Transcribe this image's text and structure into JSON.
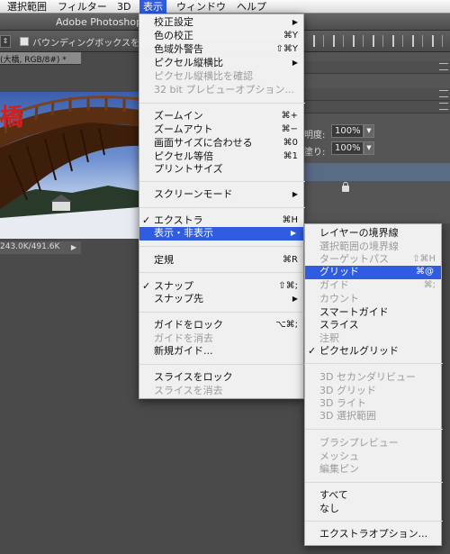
{
  "menubar": {
    "items": [
      {
        "label": "選択範囲"
      },
      {
        "label": "フィルター"
      },
      {
        "label": "3D"
      },
      {
        "label": "表示"
      },
      {
        "label": "ウィンドウ"
      },
      {
        "label": "ヘルプ"
      }
    ]
  },
  "app": {
    "title": "Adobe Photoshop",
    "options_bar": {
      "checkbox_label": "バウンディングボックスを表示",
      "select_arrow": "⇕"
    },
    "doc_tab": "(大橋, RGB/8#) *",
    "status": "243.0K/491.6K",
    "status_arrow": "▶",
    "canvas_text": "橋",
    "panel": {
      "opacity_label": "明度:",
      "opacity_value": "100%",
      "fill_label": "塗り:",
      "fill_value": "100%",
      "arrow": "▼"
    }
  },
  "view_menu": {
    "items": [
      {
        "label": "校正設定",
        "shortcut": "",
        "submenu": true,
        "disabled": false
      },
      {
        "label": "色の校正",
        "shortcut": "⌘Y",
        "disabled": false
      },
      {
        "label": "色域外警告",
        "shortcut": "⇧⌘Y",
        "disabled": false
      },
      {
        "label": "ピクセル縦横比",
        "shortcut": "",
        "submenu": true,
        "disabled": false
      },
      {
        "label": "ピクセル縦横比を確認",
        "shortcut": "",
        "disabled": true
      },
      {
        "label": "32 bit プレビューオプション...",
        "shortcut": "",
        "disabled": true
      },
      {
        "label": "ズームイン",
        "shortcut": "⌘+",
        "disabled": false
      },
      {
        "label": "ズームアウト",
        "shortcut": "⌘−",
        "disabled": false
      },
      {
        "label": "画面サイズに合わせる",
        "shortcut": "⌘0",
        "disabled": false
      },
      {
        "label": "ピクセル等倍",
        "shortcut": "⌘1",
        "disabled": false
      },
      {
        "label": "プリントサイズ",
        "shortcut": "",
        "disabled": false
      },
      {
        "label": "スクリーンモード",
        "shortcut": "",
        "submenu": true,
        "disabled": false
      },
      {
        "label": "エクストラ",
        "shortcut": "⌘H",
        "checked": true,
        "disabled": false
      },
      {
        "label": "表示・非表示",
        "shortcut": "",
        "submenu": true,
        "highlighted": true,
        "disabled": false
      },
      {
        "label": "定規",
        "shortcut": "⌘R",
        "disabled": false
      },
      {
        "label": "スナップ",
        "shortcut": "⇧⌘;",
        "checked": true,
        "disabled": false
      },
      {
        "label": "スナップ先",
        "shortcut": "",
        "submenu": true,
        "disabled": false
      },
      {
        "label": "ガイドをロック",
        "shortcut": "⌥⌘;",
        "disabled": false
      },
      {
        "label": "ガイドを消去",
        "shortcut": "",
        "disabled": true
      },
      {
        "label": "新規ガイド...",
        "shortcut": "",
        "disabled": false
      },
      {
        "label": "スライスをロック",
        "shortcut": "",
        "disabled": false
      },
      {
        "label": "スライスを消去",
        "shortcut": "",
        "disabled": true
      }
    ]
  },
  "show_submenu": {
    "items": [
      {
        "label": "レイヤーの境界線",
        "shortcut": "",
        "disabled": false
      },
      {
        "label": "選択範囲の境界線",
        "shortcut": "",
        "disabled": true
      },
      {
        "label": "ターゲットパス",
        "shortcut": "⇧⌘H",
        "disabled": true
      },
      {
        "label": "グリッド",
        "shortcut": "⌘@",
        "highlighted": true,
        "disabled": false
      },
      {
        "label": "ガイド",
        "shortcut": "⌘;",
        "disabled": true
      },
      {
        "label": "カウント",
        "shortcut": "",
        "disabled": true
      },
      {
        "label": "スマートガイド",
        "shortcut": "",
        "disabled": false
      },
      {
        "label": "スライス",
        "shortcut": "",
        "disabled": false
      },
      {
        "label": "注釈",
        "shortcut": "",
        "disabled": true
      },
      {
        "label": "ピクセルグリッド",
        "shortcut": "",
        "checked": true,
        "disabled": false
      },
      {
        "label": "3D セカンダリビュー",
        "shortcut": "",
        "disabled": true
      },
      {
        "label": "3D グリッド",
        "shortcut": "",
        "disabled": true
      },
      {
        "label": "3D ライト",
        "shortcut": "",
        "disabled": true
      },
      {
        "label": "3D 選択範囲",
        "shortcut": "",
        "disabled": true
      },
      {
        "label": "ブラシプレビュー",
        "shortcut": "",
        "disabled": true
      },
      {
        "label": "メッシュ",
        "shortcut": "",
        "disabled": true
      },
      {
        "label": "編集ピン",
        "shortcut": "",
        "disabled": true
      },
      {
        "label": "すべて",
        "shortcut": "",
        "disabled": false
      },
      {
        "label": "なし",
        "shortcut": "",
        "disabled": false
      },
      {
        "label": "エクストラオプション...",
        "shortcut": "",
        "disabled": false
      }
    ]
  },
  "glyphs": {
    "check": "✓",
    "submenu_arrow": "▶"
  },
  "colors": {
    "highlight": "#2f5ce0",
    "canvas_text": "#cc2222"
  }
}
